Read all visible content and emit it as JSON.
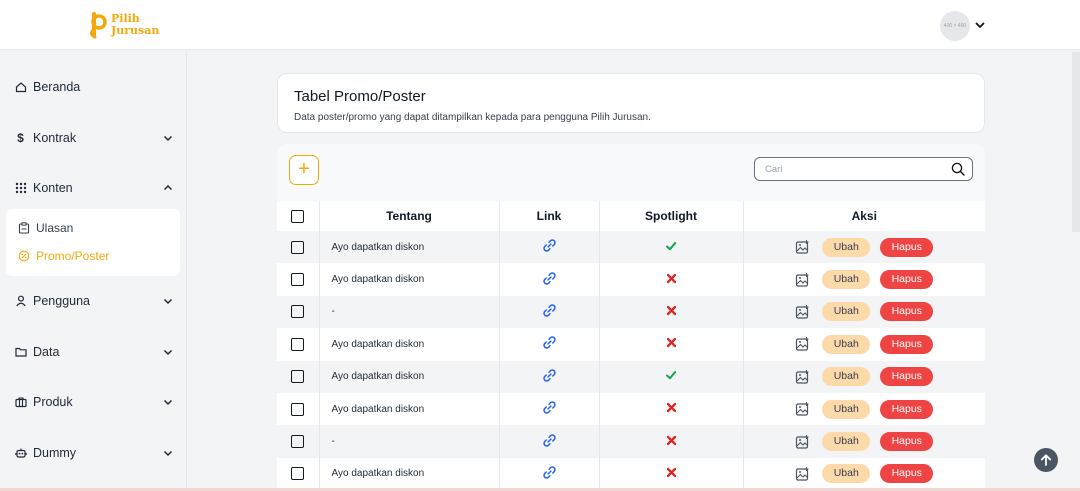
{
  "app": {
    "logo_line1": "Pilih",
    "logo_line2": "Jurusan",
    "avatar_text": "400 × 400"
  },
  "sidebar": {
    "items": [
      {
        "label": "Beranda",
        "icon": "home-icon"
      },
      {
        "label": "Kontrak",
        "icon": "dollar-icon"
      },
      {
        "label": "Konten",
        "icon": "grid-icon"
      },
      {
        "label": "Pengguna",
        "icon": "user-icon"
      },
      {
        "label": "Data",
        "icon": "folder-icon"
      },
      {
        "label": "Produk",
        "icon": "briefcase-icon"
      },
      {
        "label": "Dummy",
        "icon": "robot-icon"
      }
    ],
    "submenu": [
      {
        "label": "Ulasan",
        "icon": "clipboard-icon"
      },
      {
        "label": "Promo/Poster",
        "icon": "badge-icon"
      }
    ]
  },
  "page": {
    "title": "Tabel Promo/Poster",
    "subtitle": "Data poster/promo yang dapat ditampilkan kepada para pengguna Pilih Jurusan."
  },
  "toolbar": {
    "add_label": "+",
    "search_placeholder": "Cari"
  },
  "table": {
    "headers": {
      "about": "Tentang",
      "link": "Link",
      "spotlight": "Spotlight",
      "actions": "Aksi"
    },
    "edit_label": "Ubah",
    "delete_label": "Hapus",
    "rows": [
      {
        "about": "Ayo dapatkan diskon",
        "spotlight": true
      },
      {
        "about": "Ayo dapatkan diskon",
        "spotlight": false
      },
      {
        "about": "-",
        "spotlight": false
      },
      {
        "about": "Ayo dapatkan diskon",
        "spotlight": false
      },
      {
        "about": "Ayo dapatkan diskon",
        "spotlight": true
      },
      {
        "about": "Ayo dapatkan diskon",
        "spotlight": false
      },
      {
        "about": "-",
        "spotlight": false
      },
      {
        "about": "Ayo dapatkan diskon",
        "spotlight": false
      }
    ]
  },
  "colors": {
    "accent": "#f2a90c",
    "edit_bg": "#fcd9a8",
    "delete_bg": "#ef4444",
    "link": "#2563eb",
    "check": "#16a34a",
    "cross": "#dc2626"
  }
}
